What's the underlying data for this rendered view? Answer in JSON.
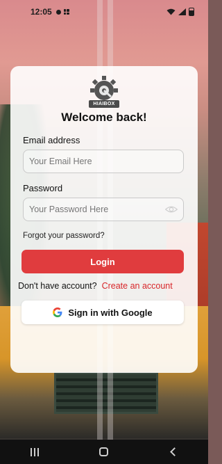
{
  "status_bar": {
    "time": "12:05"
  },
  "logo": {
    "text": "HIAIBOX"
  },
  "login_form": {
    "title": "Welcome back!",
    "email_label": "Email address",
    "email_placeholder": "Your Email Here",
    "password_label": "Password",
    "password_placeholder": "Your Password Here",
    "forgot_password": "Forgot your password?",
    "login_button": "Login",
    "no_account_text": "Don't have account?",
    "create_account_link": "Create an account",
    "google_button": "Sign in with Google"
  },
  "colors": {
    "accent": "#e03c3e",
    "link": "#d8262a"
  },
  "icons": {
    "password_toggle": "eye-icon",
    "google": "google-icon"
  }
}
